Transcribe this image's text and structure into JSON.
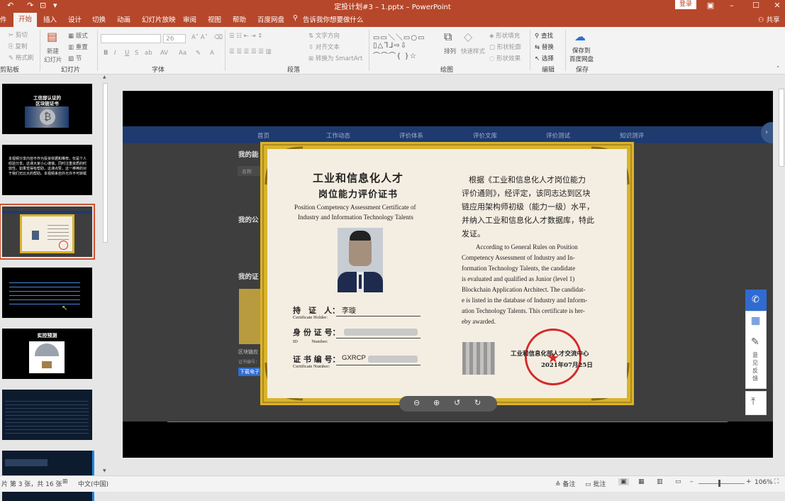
{
  "window": {
    "title": "定投计划#3 – 1.pptx – PowerPoint",
    "login_label": "登录",
    "share_label": "共享"
  },
  "tabs": [
    "件",
    "开始",
    "插入",
    "设计",
    "切换",
    "动画",
    "幻灯片放映",
    "审阅",
    "视图",
    "帮助",
    "百度网盘"
  ],
  "tell_me": "告诉我你想要做什么",
  "ribbon": {
    "clipboard": {
      "group": "剪贴板",
      "cut": "剪切",
      "copy": "复制",
      "format_painter": "格式刷"
    },
    "slides": {
      "group": "幻灯片",
      "new_slide": "新建",
      "new_slide2": "幻灯片",
      "layout": "版式",
      "reset": "重置",
      "section": "节"
    },
    "font": {
      "group": "字体",
      "size": "26"
    },
    "paragraph": {
      "group": "段落",
      "text_direction": "文字方向",
      "align_text": "对齐文本",
      "smartart": "转换为 SmartArt"
    },
    "drawing": {
      "group": "绘图",
      "arrange": "排列",
      "quick_styles": "快速样式",
      "shape_fill": "形状填充",
      "shape_outline": "形状轮廓",
      "shape_effects": "形状效果"
    },
    "editing": {
      "group": "编辑",
      "find": "查找",
      "replace": "替换",
      "select": "选择"
    },
    "save": {
      "group": "保存",
      "label1": "保存到",
      "label2": "百度网盘"
    }
  },
  "thumbnails": [
    {
      "number": "1",
      "title": "工信部认证的",
      "subtitle": "区块链证书"
    },
    {
      "number": "2",
      "text": "本视频分享内容不作为投资依据和推荐，仅是个人经验分享。这课大家小心谨慎，同时注重资质的时效性。如果觉得有帮助，这课点赞，这一棒棒的对于我们无比大的帮助。本视频来自外允许不可转载"
    },
    {
      "number": "3"
    },
    {
      "number": "4"
    },
    {
      "number": "5",
      "title": "实控预测"
    },
    {
      "number": "6"
    },
    {
      "number": "7"
    }
  ],
  "website": {
    "nav": [
      "首页",
      "工作动态",
      "评价体系",
      "评价文库",
      "评价测试",
      "知识测评"
    ],
    "sections": [
      "我的能",
      "我的公",
      "我的证"
    ],
    "table_header": "名称",
    "cert_caption": "区块链应",
    "cert_caption2": "证书编号：",
    "download": "下载电子"
  },
  "certificate": {
    "title_line1": "工业和信息化人才",
    "title_line2": "岗位能力评价证书",
    "en_title_line1": "Position Competency Assessment Certificate of",
    "en_title_line2": "Industry and Information Technology Talents",
    "cn_body_1": "根据《工业和信息化人才岗位能力",
    "cn_body_2": "评价通则》，经评定，该同志达到区块",
    "cn_body_3": "链应用架构师初级（能力一级）水平，",
    "cn_body_4": "并纳入工业和信息化人才数据库，特此",
    "cn_body_5": "发证。",
    "en_body_1": "According to General Rules on Position",
    "en_body_2": "Competency Assessment of Industry and In-",
    "en_body_3": "formation Technology Talents, the candidate",
    "en_body_4": "is evaluated and qualified as Junior (level 1)",
    "en_body_5": "Blockchain Application Architect. The candidat-",
    "en_body_6": "e is listed in the database of Industry and Inform-",
    "en_body_7": "ation Technology Talents. This certificate is her-",
    "en_body_8": "eby awarded.",
    "holder_label": "持　证　人：",
    "holder_en": "Certificate Holder:",
    "holder_name": "李璇",
    "id_label": "身 份 证 号：",
    "id_en": "ID　　　Number:",
    "cert_no_label": "证 书 编 号：",
    "cert_no_en": "Certificate Number:",
    "cert_no_prefix": "GXRCP",
    "issuer": "工业和信息化部人才交流中心",
    "date": "2021年07月25日",
    "stamp_text": "工业和信息化部人才交流中心"
  },
  "side_widget": {
    "feedback": "意见反馈"
  },
  "status": {
    "slide_info": "片 第 3 张，共 16 张",
    "language": "中文(中国)",
    "notes": "备注",
    "comments": "批注",
    "zoom": "106%"
  }
}
